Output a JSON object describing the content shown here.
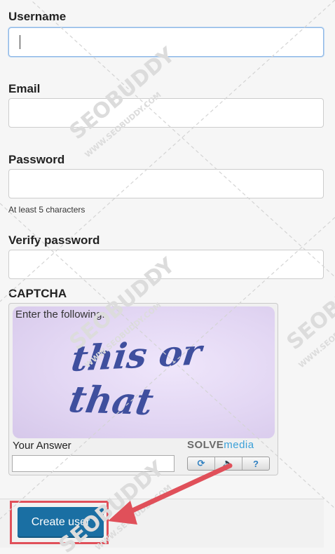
{
  "form": {
    "username_label": "Username",
    "username_value": "",
    "email_label": "Email",
    "email_value": "",
    "password_label": "Password",
    "password_value": "",
    "password_hint": "At least 5 characters",
    "verify_label": "Verify password",
    "verify_value": ""
  },
  "captcha": {
    "section_label": "CAPTCHA",
    "prompt": "Enter the following:",
    "image_word_1": "this or",
    "image_word_2": "that",
    "answer_label": "Your Answer",
    "answer_value": "",
    "brand_part_1": "SOLVE",
    "brand_part_2": "media",
    "buttons": [
      {
        "icon": "refresh-icon",
        "glyph": "⟳"
      },
      {
        "icon": "audio-icon",
        "glyph": "🔈"
      },
      {
        "icon": "help-icon",
        "glyph": "?"
      }
    ]
  },
  "actions": {
    "create_label": "Create user"
  },
  "watermark": {
    "brand": "SEOBUDDY",
    "site": "WWW.SEOBUDDY.COM"
  },
  "colors": {
    "button_primary": "#1a6fa3",
    "annotation_red": "#e0505a"
  }
}
